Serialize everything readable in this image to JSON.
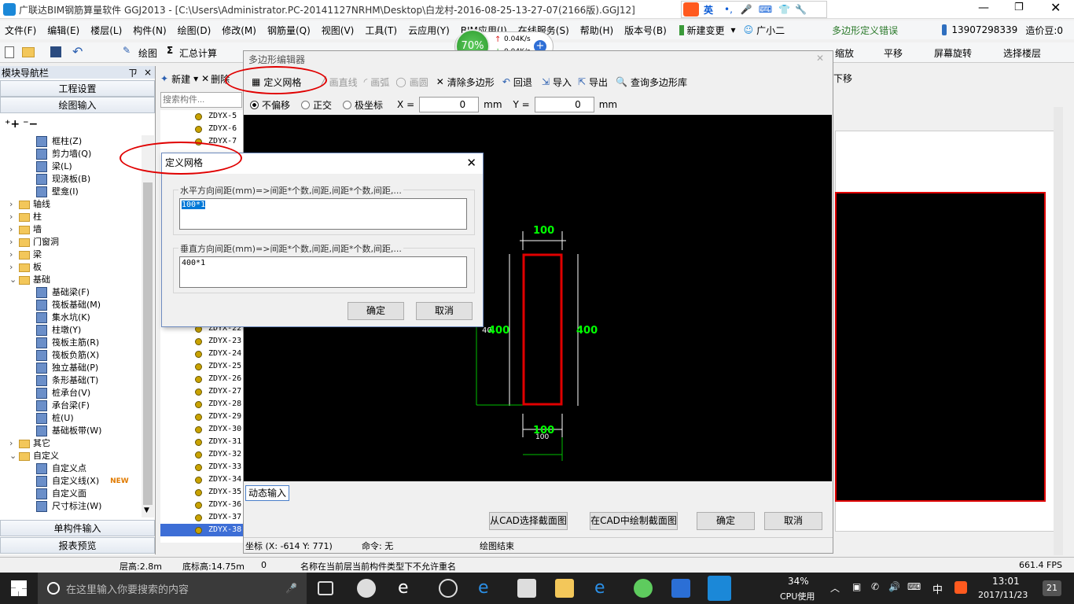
{
  "window": {
    "title": "广联达BIM钢筋算量软件 GGJ2013 - [C:\\Users\\Administrator.PC-20141127NRHM\\Desktop\\白龙村-2016-08-25-13-27-07(2166版).GGJ12]"
  },
  "ime": {
    "mode": "英"
  },
  "menu": {
    "items": [
      "文件(F)",
      "编辑(E)",
      "楼层(L)",
      "构件(N)",
      "绘图(D)",
      "修改(M)",
      "钢筋量(Q)",
      "视图(V)",
      "工具(T)",
      "云应用(Y)",
      "BIM应用(I)",
      "在线服务(S)",
      "帮助(H)",
      "版本号(B)"
    ],
    "new_change": "新建变更",
    "assistant": "广小二",
    "error_notice": "多边形定义错误",
    "account": "13907298339",
    "beans": "造价豆:0"
  },
  "netmeter": {
    "percent": "70%",
    "up": "0.04K/s",
    "down": "0.04K/s"
  },
  "toolbar": {
    "draw": "绘图",
    "sum": "汇总计算",
    "zoom": "缩放",
    "pan": "平移",
    "rotate": "屏幕旋转",
    "select_floor": "选择楼层",
    "offset": "下移"
  },
  "nav": {
    "title": "模块导航栏",
    "pin": "ㄗ",
    "close": "×",
    "project_settings": "工程设置",
    "draw_input": "绘图输入",
    "single_input": "单构件输入",
    "report": "报表预览"
  },
  "tree": {
    "items": [
      {
        "label": "框柱(Z)",
        "indent": 1,
        "folder": false
      },
      {
        "label": "剪力墙(Q)",
        "indent": 1,
        "folder": false
      },
      {
        "label": "梁(L)",
        "indent": 1,
        "folder": false
      },
      {
        "label": "现浇板(B)",
        "indent": 1,
        "folder": false
      },
      {
        "label": "壁龛(I)",
        "indent": 1,
        "folder": false
      },
      {
        "label": "轴线",
        "indent": 0,
        "folder": true
      },
      {
        "label": "柱",
        "indent": 0,
        "folder": true
      },
      {
        "label": "墙",
        "indent": 0,
        "folder": true
      },
      {
        "label": "门窗洞",
        "indent": 0,
        "folder": true
      },
      {
        "label": "梁",
        "indent": 0,
        "folder": true
      },
      {
        "label": "板",
        "indent": 0,
        "folder": true
      },
      {
        "label": "基础",
        "indent": 0,
        "folder": true
      },
      {
        "label": "基础梁(F)",
        "indent": 1,
        "folder": false
      },
      {
        "label": "筏板基础(M)",
        "indent": 1,
        "folder": false
      },
      {
        "label": "集水坑(K)",
        "indent": 1,
        "folder": false
      },
      {
        "label": "柱墩(Y)",
        "indent": 1,
        "folder": false
      },
      {
        "label": "筏板主筋(R)",
        "indent": 1,
        "folder": false
      },
      {
        "label": "筏板负筋(X)",
        "indent": 1,
        "folder": false
      },
      {
        "label": "独立基础(P)",
        "indent": 1,
        "folder": false
      },
      {
        "label": "条形基础(T)",
        "indent": 1,
        "folder": false
      },
      {
        "label": "桩承台(V)",
        "indent": 1,
        "folder": false
      },
      {
        "label": "承台梁(F)",
        "indent": 1,
        "folder": false
      },
      {
        "label": "桩(U)",
        "indent": 1,
        "folder": false
      },
      {
        "label": "基础板带(W)",
        "indent": 1,
        "folder": false
      },
      {
        "label": "其它",
        "indent": 0,
        "folder": true
      },
      {
        "label": "自定义",
        "indent": 0,
        "folder": true
      },
      {
        "label": "自定义点",
        "indent": 1,
        "folder": false
      },
      {
        "label": "自定义线(X)",
        "indent": 1,
        "folder": false
      },
      {
        "label": "自定义面",
        "indent": 1,
        "folder": false
      },
      {
        "label": "尺寸标注(W)",
        "indent": 1,
        "folder": false
      }
    ],
    "new_badge": "NEW"
  },
  "components": {
    "new_label": "新建",
    "delete_label": "删除",
    "search_placeholder": "搜索构件...",
    "items": [
      "ZDYX-5",
      "ZDYX-6",
      "ZDYX-7",
      "ZDYX-22",
      "ZDYX-23",
      "ZDYX-24",
      "ZDYX-25",
      "ZDYX-26",
      "ZDYX-27",
      "ZDYX-28",
      "ZDYX-29",
      "ZDYX-30",
      "ZDYX-31",
      "ZDYX-32",
      "ZDYX-33",
      "ZDYX-34",
      "ZDYX-35",
      "ZDYX-36",
      "ZDYX-37",
      "ZDYX-38"
    ]
  },
  "poly_editor": {
    "title": "多边形编辑器",
    "tools": {
      "define_grid": "定义网格",
      "draw_line": "画直线",
      "draw_arc": "画弧",
      "draw_circle": "画圆",
      "clear": "清除多边形",
      "undo": "回退",
      "import": "导入",
      "export": "导出",
      "query": "查询多边形库"
    },
    "mode": {
      "no_offset": "不偏移",
      "ortho": "正交",
      "polar": "极坐标"
    },
    "x_label": "X =",
    "x_value": "0",
    "y_label": "Y =",
    "y_value": "0",
    "unit": "mm",
    "dims": {
      "top": "100",
      "bottom": "100",
      "bottom_white": "100",
      "right": "400",
      "left": "400",
      "left_white": "40"
    },
    "dynamic_input": "动态输入",
    "cad_select": "从CAD选择截面图",
    "cad_draw": "在CAD中绘制截面图",
    "ok": "确定",
    "cancel": "取消",
    "status": {
      "coord": "坐标 (X: -614 Y: 771)",
      "command": "命令: 无",
      "state": "绘图结束"
    }
  },
  "grid_dialog": {
    "title": "定义网格",
    "h_label": "水平方向间距(mm)=>间距*个数,间距,间距*个数,间距,...",
    "h_value": "100*1",
    "v_label": "垂直方向间距(mm)=>间距*个数,间距,间距*个数,间距,...",
    "v_value": "400*1",
    "ok": "确定",
    "cancel": "取消"
  },
  "statusbar": {
    "floor_height": "层高:2.8m",
    "base_height": "底标高:14.75m",
    "zero": "0",
    "message": "名称在当前层当前构件类型下不允许重名",
    "fps": "661.4 FPS"
  },
  "taskbar": {
    "search_placeholder": "在这里输入你要搜索的内容",
    "cpu_percent": "34%",
    "cpu_label": "CPU使用",
    "lang": "中",
    "time": "13:01",
    "date": "2017/11/23",
    "notif": "21"
  },
  "colors": {
    "accent_red": "#e00000",
    "dim_green": "#00ff00"
  }
}
